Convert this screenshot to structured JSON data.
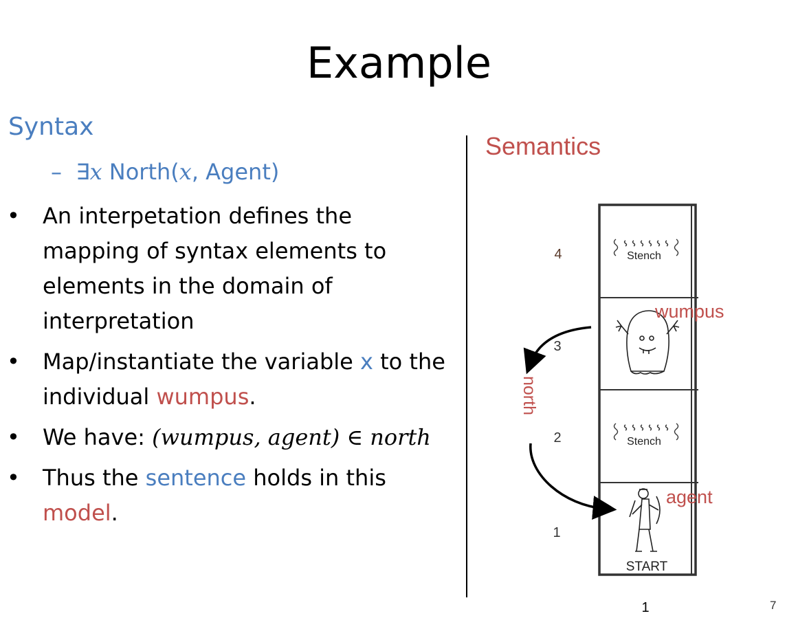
{
  "title": "Example",
  "syntax": {
    "heading": "Syntax",
    "formula_dash": "–",
    "formula_exists": "∃",
    "formula_var": "x",
    "formula_pred": " North(",
    "formula_arg": "x",
    "formula_rest": ", Agent)"
  },
  "bullets": [
    {
      "text": "An interpetation defines the mapping of syntax elements to elements in the domain of interpretation"
    },
    {
      "pre": "Map/instantiate the variable ",
      "hl1": "x",
      "mid": " to the individual ",
      "hl2": "wumpus",
      "post": "."
    },
    {
      "pre": "We have: ",
      "math": "(wumpus, agent) ∈ north"
    },
    {
      "pre": "Thus the ",
      "hl1": "sentence",
      "mid": " holds in this ",
      "hl2": "model",
      "post": "."
    }
  ],
  "semantics": {
    "heading": "Semantics",
    "row_labels": [
      "4",
      "3",
      "2",
      "1"
    ],
    "col_label": "1",
    "stench_label": "Stench",
    "start_label": "START",
    "wumpus_label": "wumpus",
    "agent_label": "agent",
    "relation_label": "north"
  },
  "colors": {
    "blue": "#4a7ebf",
    "red": "#c0504d"
  },
  "page_number": "7"
}
